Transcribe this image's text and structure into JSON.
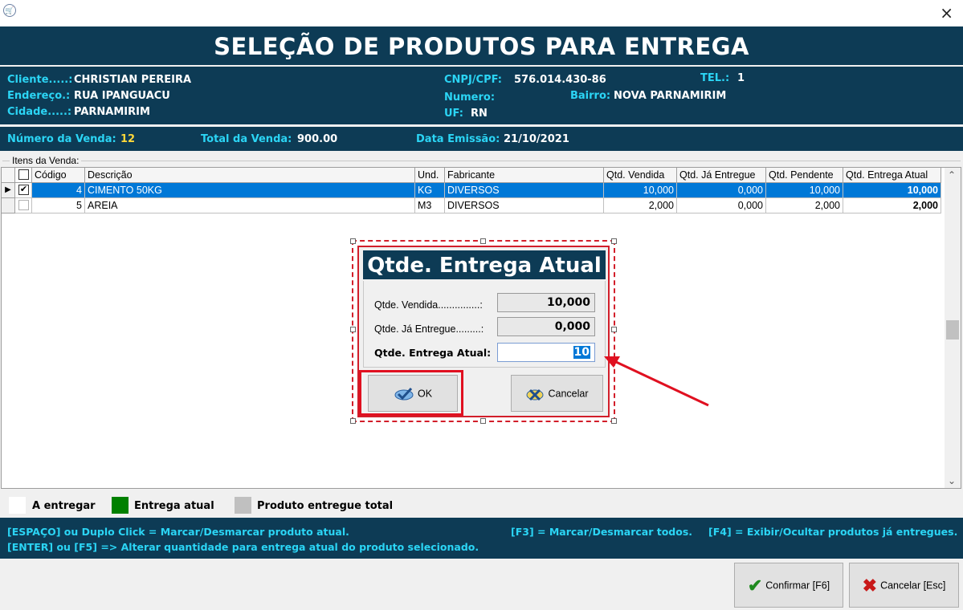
{
  "window": {
    "close_glyph": "×"
  },
  "header": {
    "title": "SELEÇÃO DE PRODUTOS PARA ENTREGA"
  },
  "cliente": {
    "cliente_label": "Cliente.....:",
    "cliente_value": "CHRISTIAN PEREIRA",
    "endereco_label": "Endereço.:",
    "endereco_value": "RUA IPANGUACU",
    "cidade_label": "Cidade.....:",
    "cidade_value": "PARNAMIRIM",
    "cnpj_label": "CNPJ/CPF:",
    "cnpj_value": "576.014.430-86",
    "tel_label": "TEL.:",
    "tel_value": "1",
    "numero_label": "Numero:",
    "numero_value": "",
    "bairro_label": "Bairro:",
    "bairro_value": "NOVA PARNAMIRIM",
    "uf_label": "UF:",
    "uf_value": "RN"
  },
  "venda": {
    "numero_label": "Número da Venda:",
    "numero_value": "12",
    "total_label": "Total da Venda:",
    "total_value": "900.00",
    "data_label": "Data Emissão:",
    "data_value": "21/10/2021"
  },
  "grid": {
    "group_label": "Itens da Venda:",
    "columns": [
      "Código",
      "Descrição",
      "Und.",
      "Fabricante",
      "Qtd. Vendida",
      "Qtd. Já Entregue",
      "Qtd. Pendente",
      "Qtd. Entrega Atual"
    ],
    "rows": [
      {
        "checked": true,
        "codigo": "4",
        "descricao": "CIMENTO 50KG",
        "und": "KG",
        "fabricante": "DIVERSOS",
        "vendida": "10,000",
        "entregue": "0,000",
        "pendente": "10,000",
        "atual": "10,000",
        "selected": true
      },
      {
        "checked": false,
        "codigo": "5",
        "descricao": "AREIA",
        "und": "M3",
        "fabricante": "DIVERSOS",
        "vendida": "2,000",
        "entregue": "0,000",
        "pendente": "2,000",
        "atual": "2,000",
        "selected": false
      }
    ]
  },
  "dialog": {
    "title": "Qtde. Entrega Atual",
    "vendida_label": "Qtde. Vendida...............:",
    "vendida_value": "10,000",
    "entregue_label": "Qtde. Já Entregue.........:",
    "entregue_value": "0,000",
    "atual_label": "Qtde. Entrega Atual:",
    "atual_value": "10",
    "ok_label": "OK",
    "cancel_label": "Cancelar"
  },
  "legend": {
    "a_entregar": "A entregar",
    "entrega_atual": "Entrega atual",
    "entregue_total": "Produto entregue total",
    "colors": {
      "a_entregar": "#ffffff",
      "entrega_atual": "#008000",
      "entregue_total": "#c0c0c0"
    }
  },
  "help": {
    "line1_left": "[ESPAÇO] ou Duplo Click = Marcar/Desmarcar produto atual.",
    "line1_mid": "[F3] = Marcar/Desmarcar todos.",
    "line1_right": "[F4] = Exibir/Ocultar produtos já entregues.",
    "line2": "[ENTER] ou [F5] => Alterar quantidade para entrega atual do produto selecionado."
  },
  "footer": {
    "confirm_label": "Confirmar [F6]",
    "cancel_label": "Cancelar [Esc]"
  },
  "colors": {
    "header_bg": "#0d3b55",
    "label_cyan": "#2bd5f5",
    "number_yellow": "#ffd83a",
    "selection_blue": "#0078d7",
    "highlight_red": "#e01020"
  }
}
